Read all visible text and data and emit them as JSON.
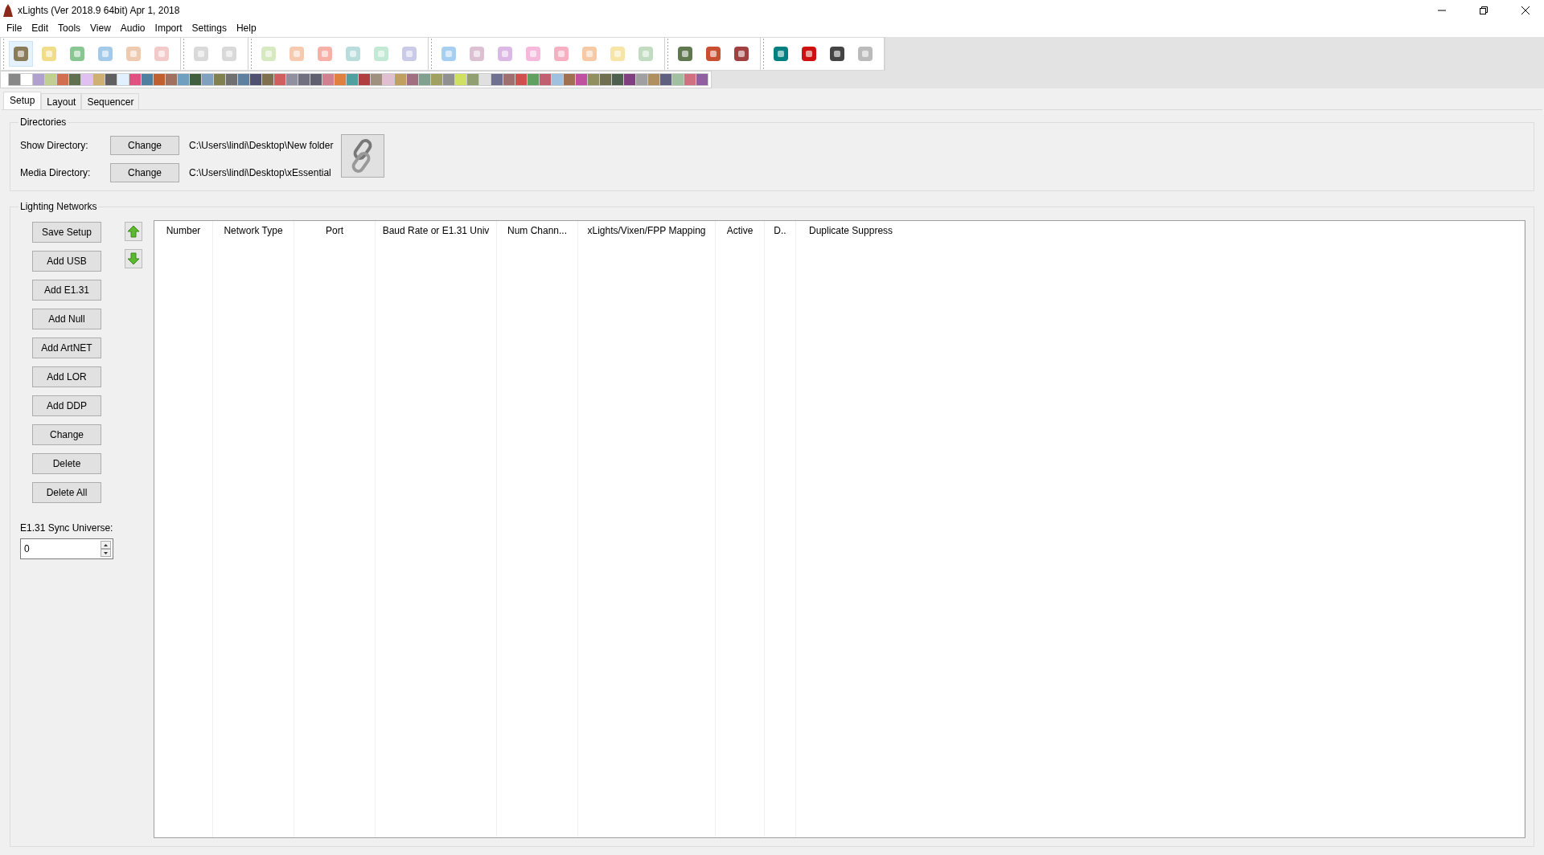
{
  "window": {
    "title": "xLights  (Ver 2018.9 64bit) Apr 1, 2018"
  },
  "menu": [
    "File",
    "Edit",
    "Tools",
    "View",
    "Audio",
    "Import",
    "Settings",
    "Help"
  ],
  "tabs": [
    {
      "label": "Setup",
      "selected": true
    },
    {
      "label": "Layout",
      "selected": false
    },
    {
      "label": "Sequencer",
      "selected": false
    }
  ],
  "directories": {
    "title": "Directories",
    "rows": [
      {
        "label": "Show Directory:",
        "button": "Change",
        "path": "C:\\Users\\lindi\\Desktop\\New folder"
      },
      {
        "label": "Media Directory:",
        "button": "Change",
        "path": "C:\\Users\\lindi\\Desktop\\xEssential"
      }
    ]
  },
  "networks": {
    "title": "Lighting Networks",
    "buttons": [
      "Save Setup",
      "Add USB",
      "Add E1.31",
      "Add Null",
      "Add ArtNET",
      "Add LOR",
      "Add DDP",
      "Change",
      "Delete",
      "Delete All"
    ],
    "sync_label": "E1.31 Sync Universe:",
    "sync_value": "0",
    "table": {
      "columns": [
        "Number",
        "Network Type",
        "Port",
        "Baud Rate or E1.31 Univ",
        "Num Chann...",
        "xLights/Vixen/FPP Mapping",
        "Active",
        "D..",
        "Duplicate Suppress"
      ]
    }
  }
}
